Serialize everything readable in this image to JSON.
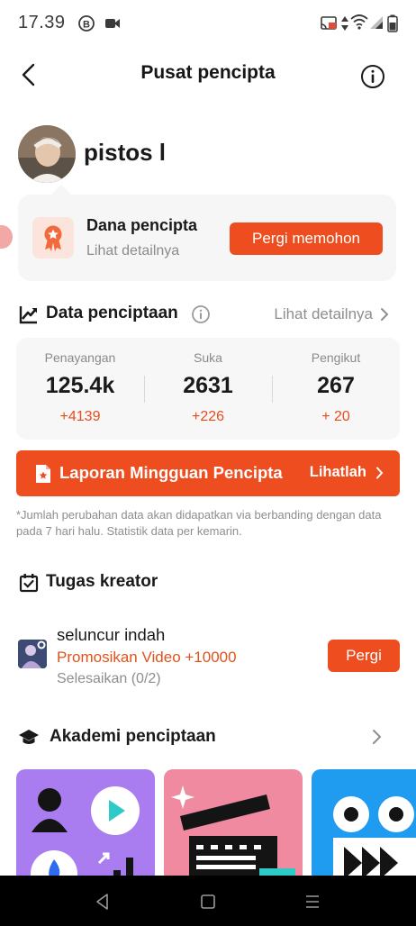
{
  "status_bar": {
    "time": "17.39",
    "icons": [
      "b-badge-icon",
      "video-camera-icon",
      "cast-icon",
      "data-arrows-icon",
      "wifi-icon",
      "signal-icon",
      "battery-icon"
    ]
  },
  "header": {
    "title": "Pusat pencipta",
    "back_icon": "back-arrow-icon",
    "info_icon": "info-circle-icon"
  },
  "profile": {
    "username": "pistos l"
  },
  "fund_card": {
    "title": "Dana pencipta",
    "subtitle": "Lihat detailnya",
    "button_label": "Pergi memohon"
  },
  "data_section": {
    "title": "Data penciptaan",
    "link_label": "Lihat detailnya",
    "stats": [
      {
        "label": "Penayangan",
        "value": "125.4k",
        "delta": "+4139"
      },
      {
        "label": "Suka",
        "value": "2631",
        "delta": "+226"
      },
      {
        "label": "Pengikut",
        "value": "267",
        "delta": "+ 20"
      }
    ]
  },
  "weekly_report": {
    "title": "Laporan Mingguan Pencipta",
    "link_label": "Lihatlah"
  },
  "footnote": "*Jumlah perubahan data akan didapatkan via berbanding dengan data pada 7 hari halu. Statistik data per kemarin.",
  "tasks_section": {
    "title": "Tugas kreator",
    "task": {
      "title": "seluncur indah",
      "promo": "Promosikan Video +10000",
      "progress": "Selesaikan (0/2)",
      "button_label": "Pergi"
    }
  },
  "academy_section": {
    "title": "Akademi penciptaan"
  },
  "colors": {
    "accent": "#ee4d1f",
    "delta_text": "#e84c1e",
    "card_bg": "#f7f7f7",
    "academy_purple": "#a97df0",
    "academy_pink": "#f08aa0",
    "academy_blue": "#1f9bf0"
  }
}
